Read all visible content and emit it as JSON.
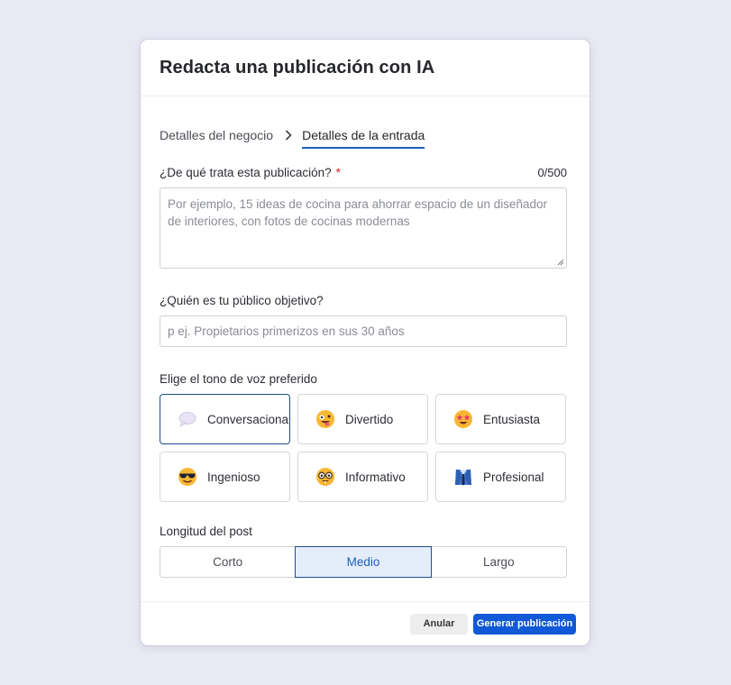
{
  "modal": {
    "title": "Redacta una publicación con IA"
  },
  "steps": [
    {
      "label": "Detalles del negocio",
      "active": false
    },
    {
      "label": "Detalles de la entrada",
      "active": true
    }
  ],
  "topic": {
    "label": "¿De qué trata esta publicación?",
    "required_mark": "*",
    "counter": "0/500",
    "value": "",
    "placeholder": "Por ejemplo, 15 ideas de cocina para ahorrar espacio de un diseñador de interiores, con fotos de cocinas modernas"
  },
  "audience": {
    "label": "¿Quién es tu público objetivo?",
    "value": "",
    "placeholder": "p ej. Propietarios primerizos en sus 30 años"
  },
  "tone": {
    "label": "Elige el tono de voz preferido",
    "selected": "Conversacional",
    "options": [
      {
        "label": "Conversacional",
        "icon": "speech-bubble-icon"
      },
      {
        "label": "Divertido",
        "icon": "zany-face-icon"
      },
      {
        "label": "Entusiasta",
        "icon": "star-struck-face-icon"
      },
      {
        "label": "Ingenioso",
        "icon": "sunglasses-face-icon"
      },
      {
        "label": "Informativo",
        "icon": "nerd-face-icon"
      },
      {
        "label": "Profesional",
        "icon": "suit-icon"
      }
    ]
  },
  "length": {
    "label": "Longitud del post",
    "selected": "Medio",
    "options": [
      "Corto",
      "Medio",
      "Largo"
    ]
  },
  "footer": {
    "cancel_label": "Anular",
    "submit_label": "Generar publicación"
  },
  "colors": {
    "accent": "#1159d6",
    "selected_border": "#1d4f8a",
    "selected_fill": "#e4eefb",
    "background": "#e9e9f4"
  }
}
